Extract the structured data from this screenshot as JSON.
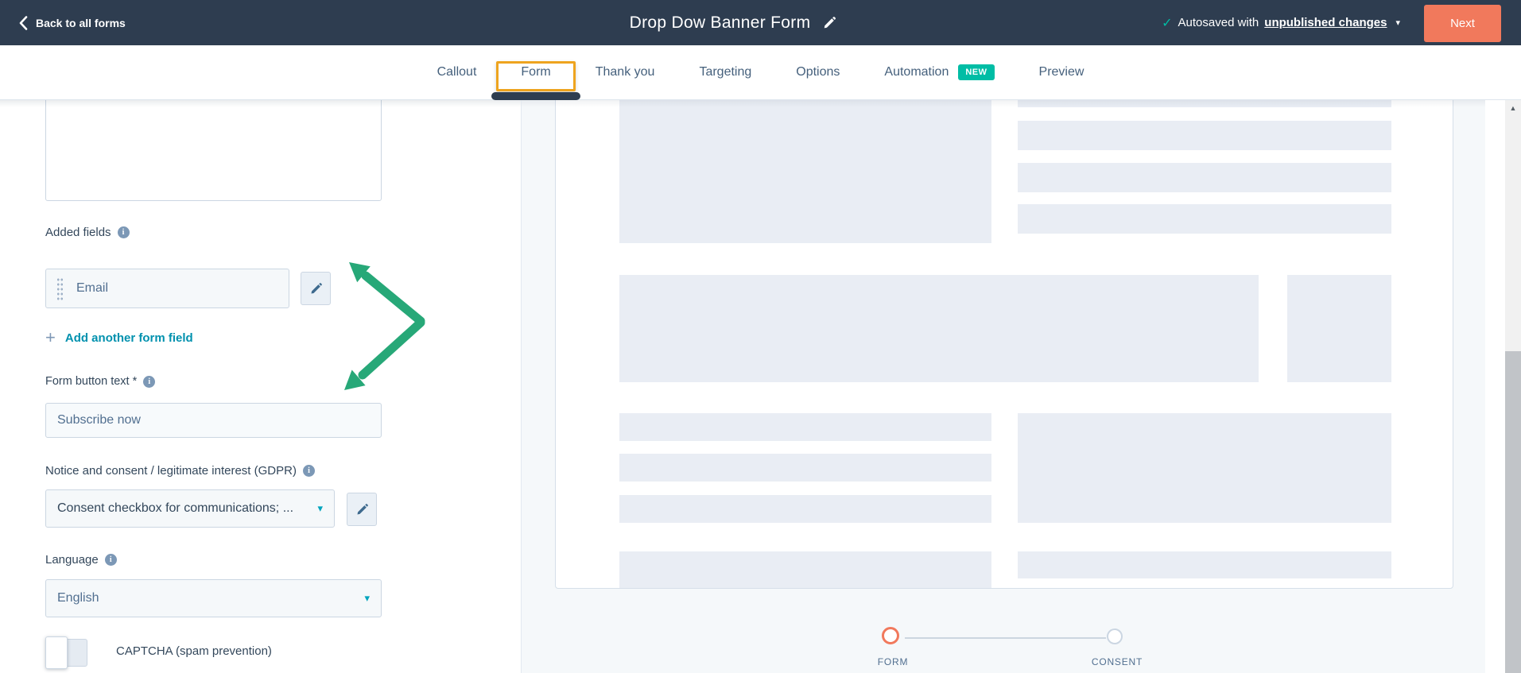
{
  "navbar": {
    "back_label": "Back to all forms",
    "title": "Drop Dow Banner Form",
    "autosave_prefix": "Autosaved with",
    "autosave_link": "unpublished changes",
    "next_label": "Next"
  },
  "tabs": {
    "items": [
      {
        "label": "Callout",
        "active": false
      },
      {
        "label": "Form",
        "active": true,
        "annotated": true
      },
      {
        "label": "Thank you",
        "active": false
      },
      {
        "label": "Targeting",
        "active": false
      },
      {
        "label": "Options",
        "active": false
      },
      {
        "label": "Automation",
        "active": false,
        "badge": "NEW"
      },
      {
        "label": "Preview",
        "active": false
      }
    ]
  },
  "editor": {
    "added_fields_label": "Added fields",
    "email_field_label": "Email",
    "add_field_link": "Add another form field",
    "form_button_label": "Form button text *",
    "form_button_value": "Subscribe now",
    "gdpr_label": "Notice and consent / legitimate interest (GDPR)",
    "gdpr_value": "Consent checkbox for communications; ...",
    "language_label": "Language",
    "language_value": "English",
    "captcha_label": "CAPTCHA (spam prevention)",
    "captcha_enabled": false
  },
  "preview": {
    "stepper": [
      {
        "label": "FORM",
        "active": true
      },
      {
        "label": "CONSENT",
        "active": false
      }
    ]
  },
  "colors": {
    "navy": "#2e3d50",
    "orange": "#f1795c",
    "teal_link": "#0091ae",
    "teal_badge": "#00bda5",
    "amber": "#eea41f",
    "green": "#27a878",
    "skeleton": "#e9edf4",
    "pane_bg": "#f5f8fa",
    "border": "#cbd6e2",
    "label": "#33475b",
    "muted": "#516f90"
  }
}
